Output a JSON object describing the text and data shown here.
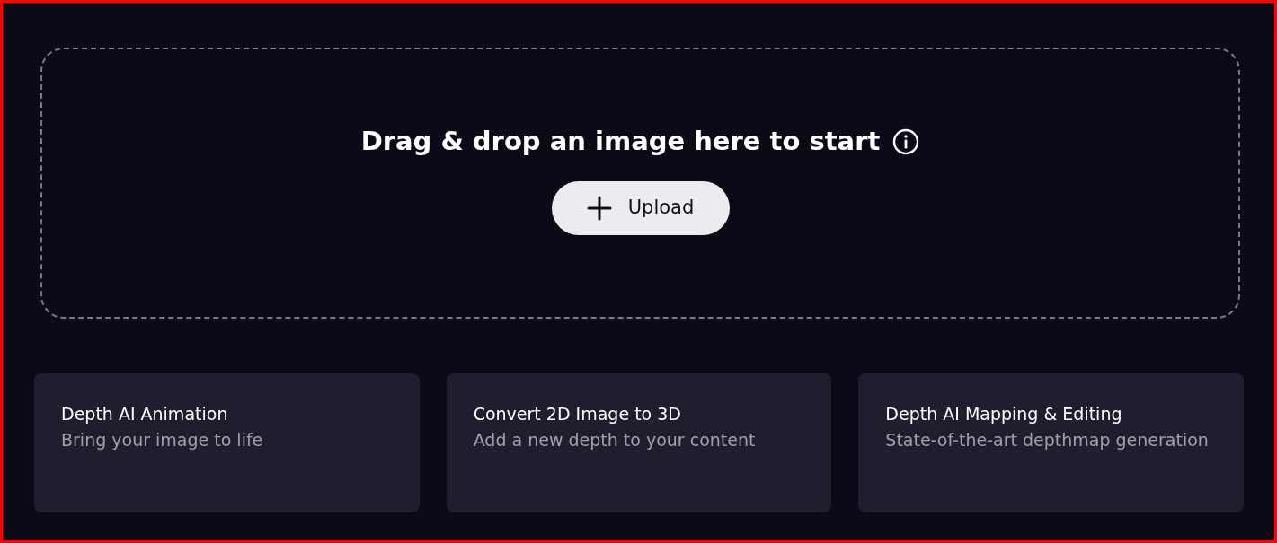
{
  "dropzone": {
    "title": "Drag & drop an image here to start",
    "upload_button": "Upload"
  },
  "cards": [
    {
      "title": "Depth AI Animation",
      "description": "Bring your image to life"
    },
    {
      "title": "Convert 2D Image to 3D",
      "description": "Add a new depth to your content"
    },
    {
      "title": "Depth AI Mapping & Editing",
      "description": "State-of-the-art depthmap generation"
    }
  ]
}
